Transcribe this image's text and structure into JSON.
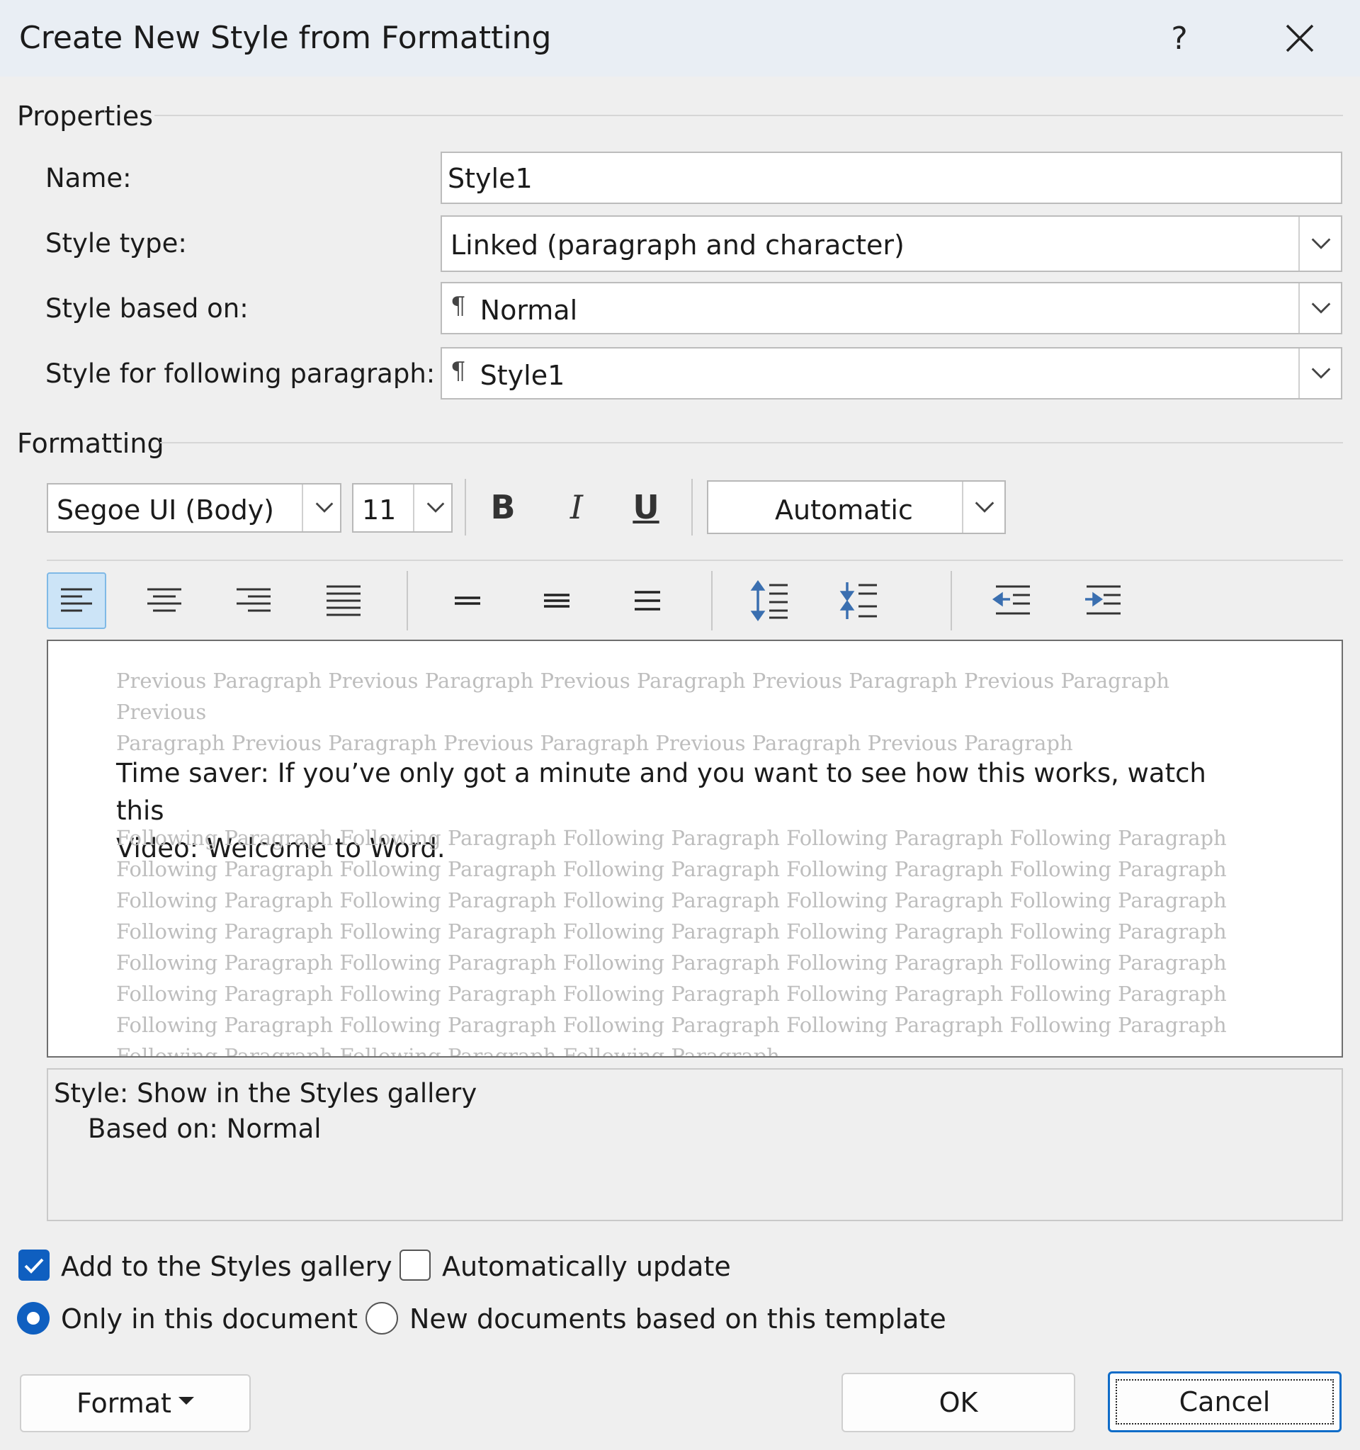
{
  "window": {
    "title": "Create New Style from Formatting",
    "help_label": "?",
    "close_icon": "close-icon"
  },
  "properties": {
    "group_label": "Properties",
    "name_label": "Name:",
    "name_value": "Style1",
    "style_type_label": "Style type:",
    "style_type_value": "Linked (paragraph and character)",
    "based_on_label": "Style based on:",
    "based_on_value": "Normal",
    "following_label": "Style for following paragraph:",
    "following_value": "Style1",
    "pilcrow": "¶"
  },
  "formatting": {
    "group_label": "Formatting",
    "font_value": "Segoe UI (Body)",
    "size_value": "11",
    "bold_label": "B",
    "italic_label": "I",
    "underline_label": "U",
    "color_value": "Automatic",
    "align_buttons": [
      "align-left-icon",
      "align-center-icon",
      "align-right-icon",
      "justify-icon"
    ],
    "spacing_buttons": [
      "single-spacing-icon",
      "one-half-spacing-icon",
      "double-spacing-icon"
    ],
    "paragraph_spacing_buttons": [
      "increase-paragraph-spacing-icon",
      "decrease-paragraph-spacing-icon"
    ],
    "indent_buttons": [
      "decrease-indent-icon",
      "increase-indent-icon"
    ]
  },
  "preview": {
    "previous_lines": [
      "Previous Paragraph Previous Paragraph Previous Paragraph Previous Paragraph Previous Paragraph Previous",
      "Paragraph Previous Paragraph Previous Paragraph Previous Paragraph Previous Paragraph"
    ],
    "main_lines": [
      "Time saver: If you’ve only got a minute and you want to see how this works, watch this",
      "Video: Welcome to Word."
    ],
    "following_lines": [
      "Following Paragraph Following Paragraph Following Paragraph Following Paragraph Following Paragraph",
      "Following Paragraph Following Paragraph Following Paragraph Following Paragraph Following Paragraph",
      "Following Paragraph Following Paragraph Following Paragraph Following Paragraph Following Paragraph",
      "Following Paragraph Following Paragraph Following Paragraph Following Paragraph Following Paragraph",
      "Following Paragraph Following Paragraph Following Paragraph Following Paragraph Following Paragraph",
      "Following Paragraph Following Paragraph Following Paragraph Following Paragraph Following Paragraph",
      "Following Paragraph Following Paragraph Following Paragraph Following Paragraph Following Paragraph",
      "Following Paragraph Following Paragraph Following Paragraph"
    ]
  },
  "description": {
    "line1": "Style: Show in the Styles gallery",
    "line2": "Based on: Normal"
  },
  "options": {
    "add_to_gallery_label": "Add to the Styles gallery",
    "add_to_gallery_checked": true,
    "auto_update_label": "Automatically update",
    "auto_update_checked": false,
    "only_this_doc_label": "Only in this document",
    "only_this_doc_selected": true,
    "new_docs_label": "New documents based on this template",
    "new_docs_selected": false
  },
  "buttons": {
    "format_label": "Format",
    "ok_label": "OK",
    "cancel_label": "Cancel"
  },
  "colors": {
    "accent": "#0f5fc0",
    "active_toolbar_bg": "#cce4f7",
    "preview_gray_text": "#bdbdbd"
  }
}
